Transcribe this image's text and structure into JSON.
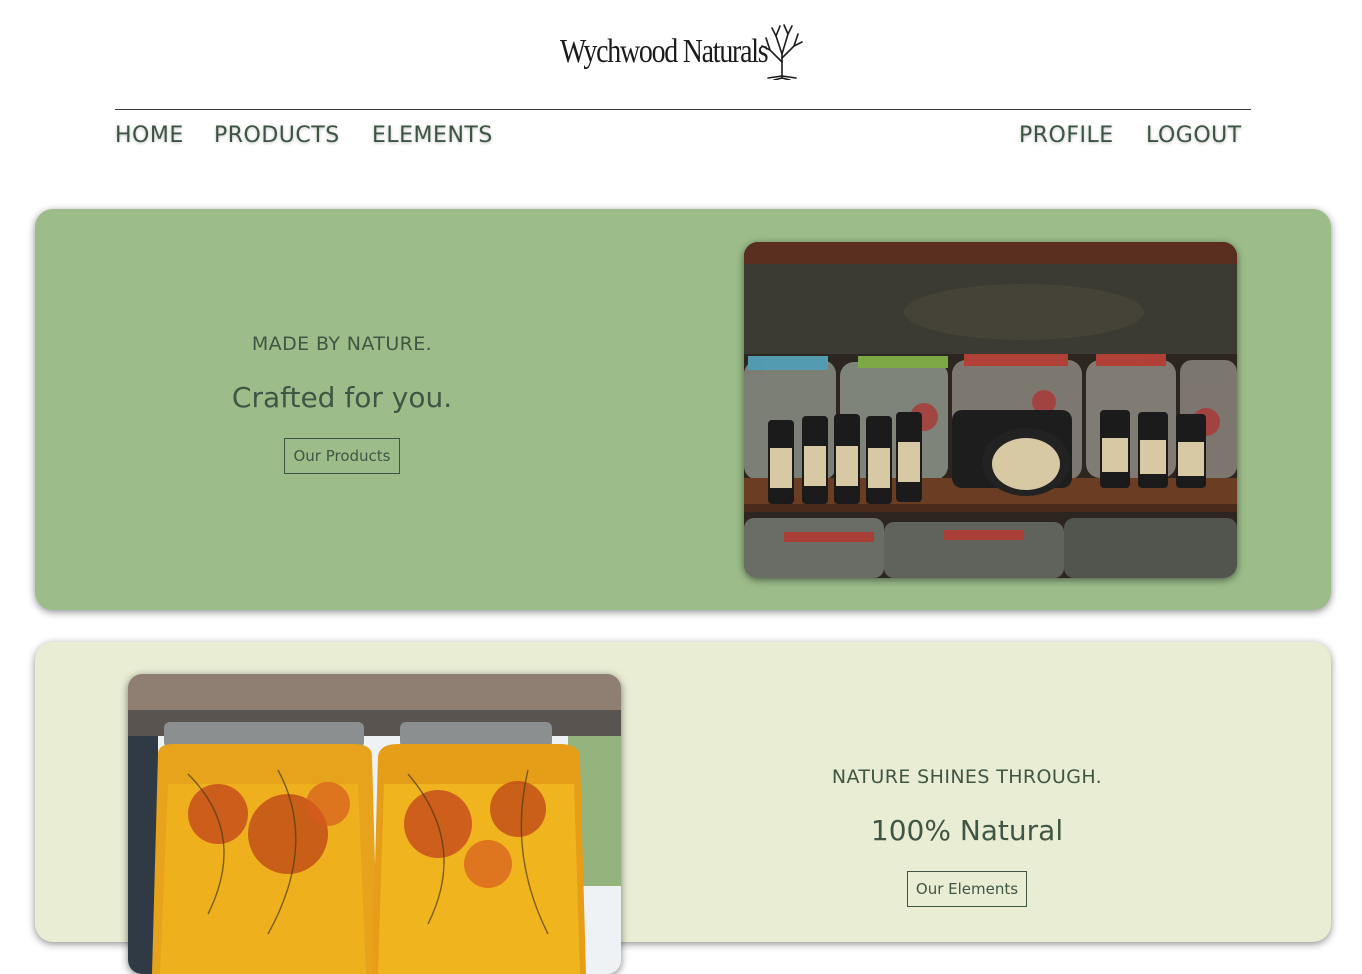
{
  "brand": {
    "name": "Wychwood Naturals",
    "logo_icon": "tree-icon"
  },
  "nav": {
    "left": [
      "HOME",
      "PRODUCTS",
      "ELEMENTS"
    ],
    "right": [
      "PROFILE",
      "LOGOUT"
    ]
  },
  "hero": {
    "tagline": "MADE BY NATURE.",
    "headline": "Crafted for you.",
    "button_label": "Our Products",
    "background": "#9cbd8a"
  },
  "feature": {
    "tagline": "NATURE SHINES THROUGH.",
    "headline": "100% Natural",
    "button_label": "Our Elements",
    "background": "#e9edd4"
  },
  "colors": {
    "text": "#3f5645",
    "nav_text": "#3c5543"
  }
}
